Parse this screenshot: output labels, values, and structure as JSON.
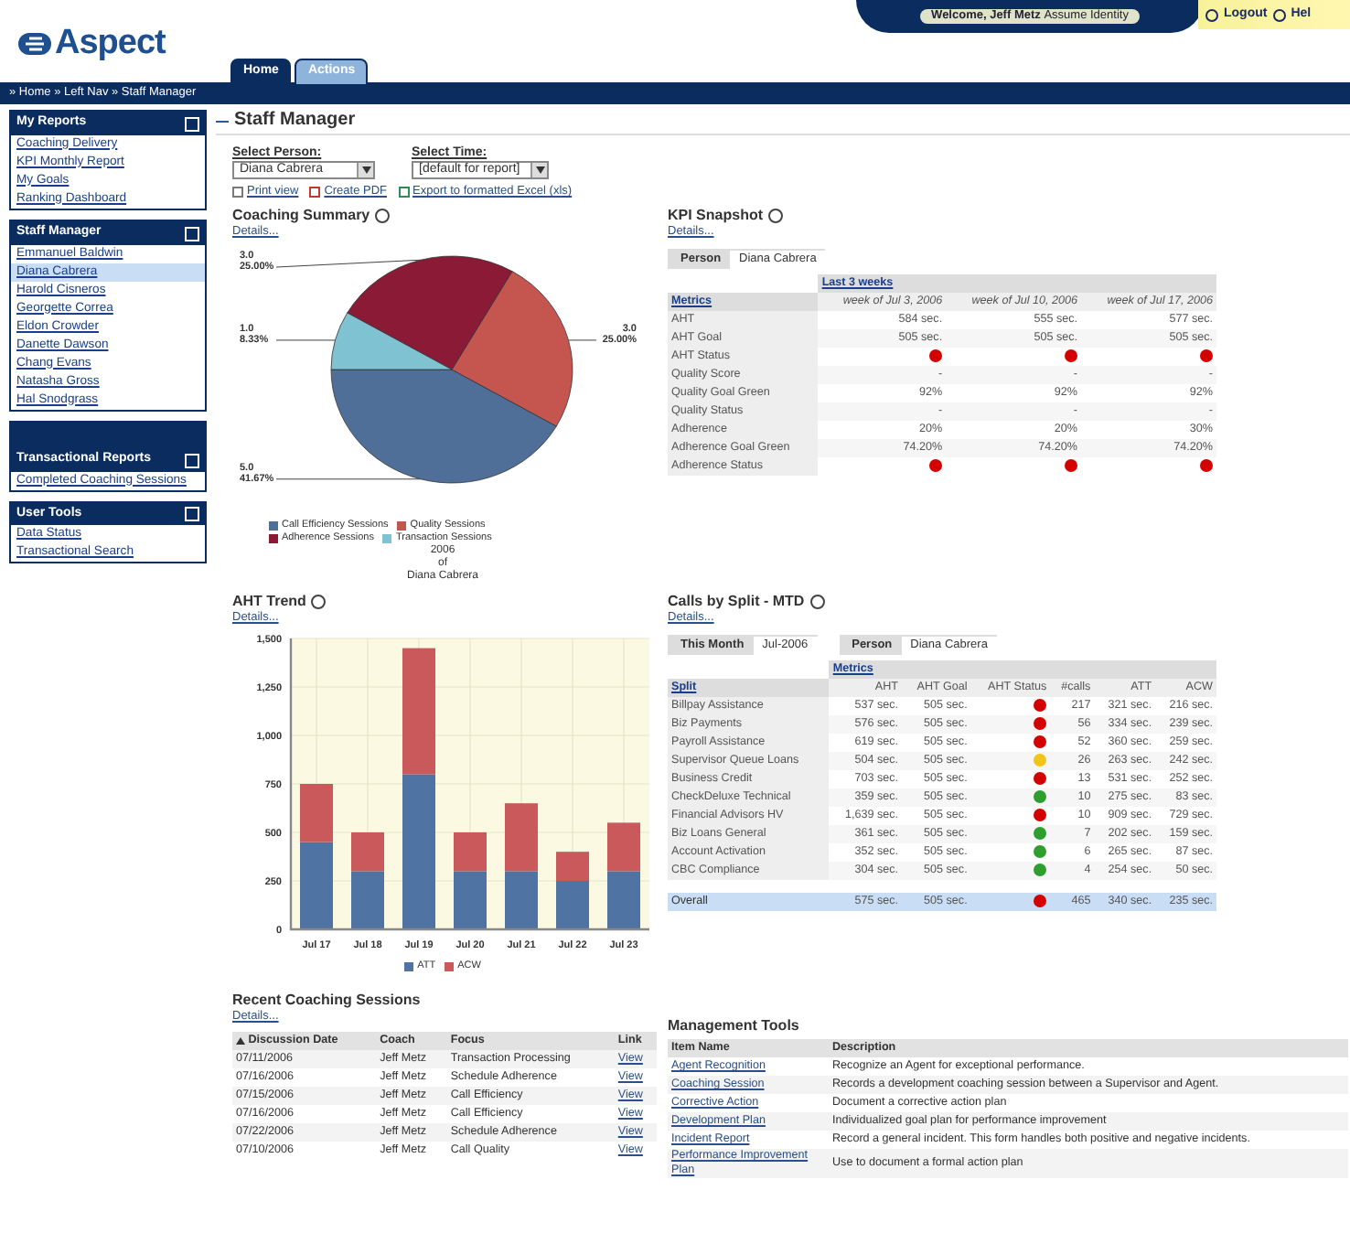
{
  "header": {
    "logo": "Aspect",
    "tabs": [
      {
        "label": "Home",
        "selected": true
      },
      {
        "label": "Actions",
        "selected": false
      }
    ],
    "welcome": "Welcome, Jeff Metz",
    "assume": "Assume Identity",
    "logout": "Logout",
    "help": "Hel"
  },
  "breadcrumb": "» Home » Left Nav » Staff Manager",
  "sidebar": [
    {
      "title": "My Reports",
      "items": [
        {
          "label": "Coaching Delivery",
          "selected": false
        },
        {
          "label": "KPI Monthly Report",
          "selected": false
        },
        {
          "label": "My Goals",
          "selected": false
        },
        {
          "label": "Ranking Dashboard",
          "selected": false
        }
      ]
    },
    {
      "title": "Staff Manager",
      "items": [
        {
          "label": "Emmanuel Baldwin",
          "selected": false
        },
        {
          "label": "Diana Cabrera",
          "selected": true
        },
        {
          "label": "Harold Cisneros",
          "selected": false
        },
        {
          "label": "Georgette Correa",
          "selected": false
        },
        {
          "label": "Eldon Crowder",
          "selected": false
        },
        {
          "label": "Danette Dawson",
          "selected": false
        },
        {
          "label": "Chang Evans",
          "selected": false
        },
        {
          "label": "Natasha Gross",
          "selected": false
        },
        {
          "label": "Hal Snodgrass",
          "selected": false
        }
      ]
    },
    {
      "title": "Transactional Reports",
      "items": [
        {
          "label": "Completed Coaching Sessions",
          "selected": false
        }
      ]
    },
    {
      "title": "User Tools",
      "items": [
        {
          "label": "Data Status",
          "selected": false
        },
        {
          "label": "Transactional Search",
          "selected": false
        }
      ]
    }
  ],
  "page_title": "Staff Manager",
  "selects": [
    {
      "label": "Select Person:",
      "value": "Diana Cabrera"
    },
    {
      "label": "Select Time:",
      "value": "[default for report]"
    }
  ],
  "actions": [
    "Print view",
    "Create PDF",
    "Export to formatted Excel (xls)"
  ],
  "coaching_summary": {
    "title": "Coaching Summary",
    "details": "Details...",
    "chart_data": {
      "type": "pie",
      "legend": "bottom",
      "categories": [
        "Call Efficiency Sessions",
        "Quality Sessions",
        "Adherence Sessions",
        "Transaction Sessions"
      ],
      "values": [
        5,
        3,
        3,
        1
      ],
      "colors": [
        "#4f6f98",
        "#c4554f",
        "#8a1a35",
        "#7fc3d3"
      ],
      "value_labels": [
        "5.0\n41.67%",
        "3.0\n25.00%",
        "3.0\n25.00%",
        "1.0\n8.33%"
      ]
    },
    "caption": [
      "2006",
      "of",
      "Diana Cabrera"
    ]
  },
  "kpi_snapshot": {
    "title": "KPI Snapshot",
    "details": "Details...",
    "filter": {
      "label": "Person",
      "value": "Diana Cabrera"
    },
    "group_header": "Last 3 weeks",
    "metrics_header": "Metrics",
    "columns": [
      "week of Jul 3, 2006",
      "week of Jul 10, 2006",
      "week of Jul 17, 2006"
    ],
    "rows": [
      {
        "metric": "AHT",
        "values": [
          {
            "kind": "text",
            "text": "584 sec."
          },
          {
            "kind": "text",
            "text": "555 sec."
          },
          {
            "kind": "text",
            "text": "577 sec."
          }
        ]
      },
      {
        "metric": "AHT Goal",
        "values": [
          {
            "kind": "text",
            "text": "505 sec."
          },
          {
            "kind": "text",
            "text": "505 sec."
          },
          {
            "kind": "text",
            "text": "505 sec."
          }
        ]
      },
      {
        "metric": "AHT Status",
        "values": [
          {
            "kind": "status",
            "color": "#d40000"
          },
          {
            "kind": "status",
            "color": "#d40000"
          },
          {
            "kind": "status",
            "color": "#d40000"
          }
        ]
      },
      {
        "metric": "Quality Score",
        "values": [
          {
            "kind": "text",
            "text": "-"
          },
          {
            "kind": "text",
            "text": "-"
          },
          {
            "kind": "text",
            "text": "-"
          }
        ]
      },
      {
        "metric": "Quality Goal Green",
        "values": [
          {
            "kind": "text",
            "text": "92%"
          },
          {
            "kind": "text",
            "text": "92%"
          },
          {
            "kind": "text",
            "text": "92%"
          }
        ]
      },
      {
        "metric": "Quality Status",
        "values": [
          {
            "kind": "text",
            "text": "-"
          },
          {
            "kind": "text",
            "text": "-"
          },
          {
            "kind": "text",
            "text": "-"
          }
        ]
      },
      {
        "metric": "Adherence",
        "values": [
          {
            "kind": "text",
            "text": "20%"
          },
          {
            "kind": "text",
            "text": "20%"
          },
          {
            "kind": "text",
            "text": "30%"
          }
        ]
      },
      {
        "metric": "Adherence Goal Green",
        "values": [
          {
            "kind": "text",
            "text": "74.20%"
          },
          {
            "kind": "text",
            "text": "74.20%"
          },
          {
            "kind": "text",
            "text": "74.20%"
          }
        ]
      },
      {
        "metric": "Adherence Status",
        "values": [
          {
            "kind": "status",
            "color": "#d40000"
          },
          {
            "kind": "status",
            "color": "#d40000"
          },
          {
            "kind": "status",
            "color": "#d40000"
          }
        ]
      }
    ]
  },
  "aht_trend": {
    "title": "AHT Trend",
    "details": "Details...",
    "chart_data": {
      "type": "bar",
      "stacked": true,
      "legend": "bottom",
      "grid": true,
      "categories": [
        "Jul 17",
        "Jul 18",
        "Jul 19",
        "Jul 20",
        "Jul 21",
        "Jul 22",
        "Jul 23"
      ],
      "series": [
        {
          "name": "ATT",
          "color": "#4f73a3",
          "values": [
            450,
            300,
            800,
            300,
            300,
            250,
            300
          ]
        },
        {
          "name": "ACW",
          "color": "#c9595b",
          "values": [
            300,
            200,
            650,
            200,
            350,
            150,
            250
          ]
        }
      ],
      "ylim": [
        0,
        1500
      ],
      "yticks": [
        0,
        250,
        500,
        750,
        {
          "value": 1000,
          "label": "1,000"
        },
        {
          "value": 1250,
          "label": "1,250"
        },
        {
          "value": 1500,
          "label": "1,500"
        }
      ]
    }
  },
  "calls_by_split": {
    "title": "Calls by Split - MTD",
    "details": "Details...",
    "filters": [
      {
        "label": "This Month",
        "value": "Jul-2006"
      },
      {
        "label": "Person",
        "value": "Diana Cabrera"
      }
    ],
    "group_header": "Metrics",
    "split_header": "Split",
    "columns": [
      "AHT",
      "AHT Goal",
      "AHT Status",
      "#calls",
      "ATT",
      "ACW"
    ],
    "rows": [
      {
        "split": "Billpay Assistance",
        "aht": "537 sec.",
        "goal": "505 sec.",
        "color": "#d40000",
        "calls": "217",
        "att": "321 sec.",
        "acw": "216 sec."
      },
      {
        "split": "Biz Payments",
        "aht": "576 sec.",
        "goal": "505 sec.",
        "color": "#d40000",
        "calls": "56",
        "att": "334 sec.",
        "acw": "239 sec."
      },
      {
        "split": "Payroll Assistance",
        "aht": "619 sec.",
        "goal": "505 sec.",
        "color": "#d40000",
        "calls": "52",
        "att": "360 sec.",
        "acw": "259 sec."
      },
      {
        "split": "Supervisor Queue Loans",
        "aht": "504 sec.",
        "goal": "505 sec.",
        "color": "#f0c419",
        "calls": "26",
        "att": "263 sec.",
        "acw": "242 sec."
      },
      {
        "split": "Business Credit",
        "aht": "703 sec.",
        "goal": "505 sec.",
        "color": "#d40000",
        "calls": "13",
        "att": "531 sec.",
        "acw": "252 sec."
      },
      {
        "split": "CheckDeluxe Technical",
        "aht": "359 sec.",
        "goal": "505 sec.",
        "color": "#2e9e2e",
        "calls": "10",
        "att": "275 sec.",
        "acw": "83 sec."
      },
      {
        "split": "Financial Advisors HV",
        "aht": "1,639 sec.",
        "goal": "505 sec.",
        "color": "#d40000",
        "calls": "10",
        "att": "909 sec.",
        "acw": "729 sec."
      },
      {
        "split": "Biz Loans General",
        "aht": "361 sec.",
        "goal": "505 sec.",
        "color": "#2e9e2e",
        "calls": "7",
        "att": "202 sec.",
        "acw": "159 sec."
      },
      {
        "split": "Account Activation",
        "aht": "352 sec.",
        "goal": "505 sec.",
        "color": "#2e9e2e",
        "calls": "6",
        "att": "265 sec.",
        "acw": "87 sec."
      },
      {
        "split": "CBC Compliance",
        "aht": "304 sec.",
        "goal": "505 sec.",
        "color": "#2e9e2e",
        "calls": "4",
        "att": "254 sec.",
        "acw": "50 sec."
      }
    ],
    "overall": {
      "split": "Overall",
      "aht": "575 sec.",
      "goal": "505 sec.",
      "color": "#d40000",
      "calls": "465",
      "att": "340 sec.",
      "acw": "235 sec."
    }
  },
  "recent_sessions": {
    "title": "Recent Coaching Sessions",
    "details": "Details...",
    "columns": [
      "Discussion Date",
      "Coach",
      "Focus",
      "Link"
    ],
    "rows": [
      [
        "07/11/2006",
        "Jeff Metz",
        "Transaction Processing",
        "View"
      ],
      [
        "07/16/2006",
        "Jeff Metz",
        "Schedule Adherence",
        "View"
      ],
      [
        "07/15/2006",
        "Jeff Metz",
        "Call Efficiency",
        "View"
      ],
      [
        "07/16/2006",
        "Jeff Metz",
        "Call Efficiency",
        "View"
      ],
      [
        "07/22/2006",
        "Jeff Metz",
        "Schedule Adherence",
        "View"
      ],
      [
        "07/10/2006",
        "Jeff Metz",
        "Call Quality",
        "View"
      ]
    ]
  },
  "management_tools": {
    "title": "Management Tools",
    "columns": [
      "Item Name",
      "Description"
    ],
    "rows": [
      [
        "Agent Recognition",
        "Recognize an Agent for exceptional performance."
      ],
      [
        "Coaching Session",
        "Records a development coaching session between a Supervisor and Agent."
      ],
      [
        "Corrective Action",
        "Document a corrective action plan"
      ],
      [
        "Development Plan",
        "Individualized goal plan for performance improvement"
      ],
      [
        "Incident Report",
        "Record a general incident. This form handles both positive and negative incidents."
      ],
      [
        "Performance Improvement Plan",
        "Use to document a formal action plan"
      ]
    ]
  }
}
